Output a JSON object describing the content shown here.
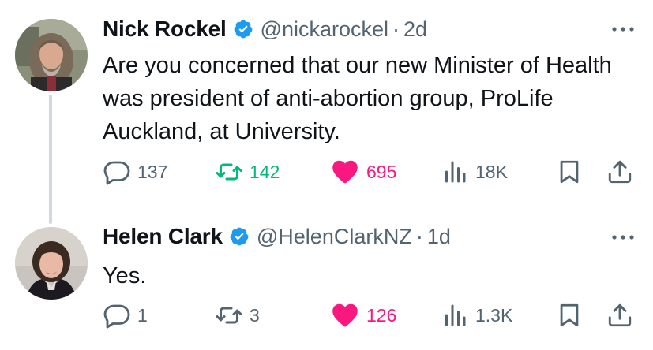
{
  "colors": {
    "text_primary": "#0f1419",
    "text_secondary": "#536471",
    "verified_blue": "#1d9bf0",
    "retweet_green": "#00ba7c",
    "like_pink": "#f91880",
    "thread_line": "#cfd9de"
  },
  "tweets": [
    {
      "author": {
        "display_name": "Nick Rockel",
        "handle": "@nickarockel",
        "verified": true
      },
      "time": "2d",
      "text": "Are you concerned that our new Minister of Health was president of anti-abortion group, ProLife Auckland, at University.",
      "stats": {
        "replies": "137",
        "retweets": "142",
        "likes": "695",
        "views": "18K"
      },
      "retweeted": true,
      "liked": true
    },
    {
      "author": {
        "display_name": "Helen Clark",
        "handle": "@HelenClarkNZ",
        "verified": true
      },
      "time": "1d",
      "text": "Yes.",
      "stats": {
        "replies": "1",
        "retweets": "3",
        "likes": "126",
        "views": "1.3K"
      },
      "retweeted": false,
      "liked": true
    }
  ],
  "separator": "·",
  "icons": {
    "verified": "verified-badge-icon",
    "more": "more-options-icon",
    "reply": "reply-icon",
    "retweet": "retweet-icon",
    "like": "heart-icon",
    "views": "views-chart-icon",
    "bookmark": "bookmark-icon",
    "share": "share-icon"
  }
}
